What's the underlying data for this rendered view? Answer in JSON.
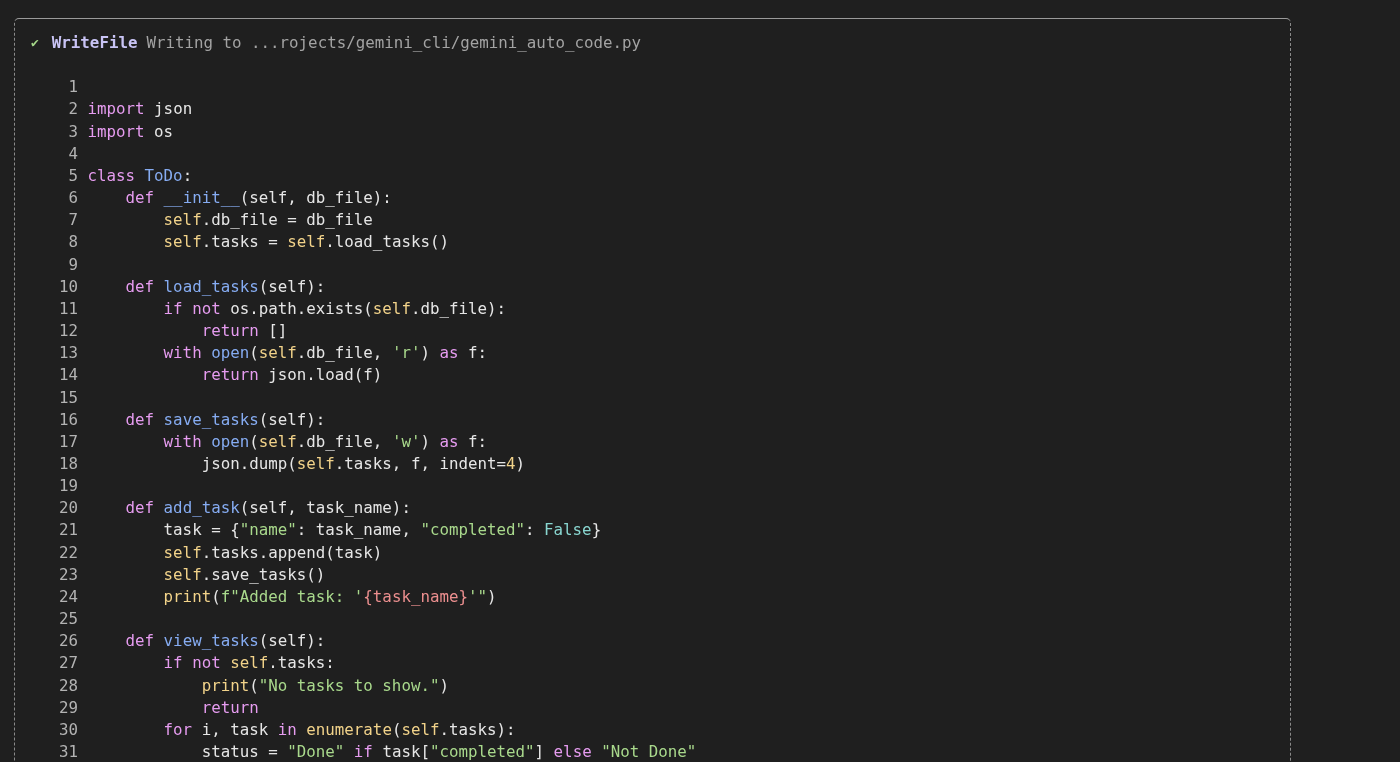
{
  "tool_call": {
    "status_icon": "✔",
    "tool_name": "WriteFile",
    "description": "Writing to ...rojects/gemini_cli/gemini_auto_code.py"
  },
  "code_lines": [
    {
      "number": "1"
    },
    {
      "number": "2",
      "tokens": [
        {
          "kind": "keyword",
          "text": "import"
        },
        {
          "kind": "plain",
          "text": " json"
        }
      ]
    },
    {
      "number": "3",
      "tokens": [
        {
          "kind": "keyword",
          "text": "import"
        },
        {
          "kind": "plain",
          "text": " os"
        }
      ]
    },
    {
      "number": "4"
    },
    {
      "number": "5",
      "tokens": [
        {
          "kind": "keyword",
          "text": "class"
        },
        {
          "kind": "name",
          "text": " ToDo"
        },
        {
          "kind": "plain",
          "text": ":"
        }
      ]
    },
    {
      "number": "6",
      "tokens": [
        {
          "kind": "keyword",
          "text": "    def"
        },
        {
          "kind": "name",
          "text": " __init__"
        },
        {
          "kind": "plain",
          "text": "(self, db_file):"
        }
      ]
    },
    {
      "number": "7",
      "tokens": [
        {
          "kind": "self",
          "text": "        self"
        },
        {
          "kind": "plain",
          "text": ".db_file = db_file"
        }
      ]
    },
    {
      "number": "8",
      "tokens": [
        {
          "kind": "self",
          "text": "        self"
        },
        {
          "kind": "plain",
          "text": ".tasks = "
        },
        {
          "kind": "self",
          "text": "self"
        },
        {
          "kind": "plain",
          "text": ".load_tasks()"
        }
      ]
    },
    {
      "number": "9"
    },
    {
      "number": "10",
      "tokens": [
        {
          "kind": "keyword",
          "text": "    def"
        },
        {
          "kind": "name",
          "text": " load_tasks"
        },
        {
          "kind": "plain",
          "text": "(self):"
        }
      ]
    },
    {
      "number": "11",
      "tokens": [
        {
          "kind": "keyword",
          "text": "        if not"
        },
        {
          "kind": "plain",
          "text": " os.path.exists("
        },
        {
          "kind": "self",
          "text": "self"
        },
        {
          "kind": "plain",
          "text": ".db_file):"
        }
      ]
    },
    {
      "number": "12",
      "tokens": [
        {
          "kind": "keyword",
          "text": "            return"
        },
        {
          "kind": "plain",
          "text": " []"
        }
      ]
    },
    {
      "number": "13",
      "tokens": [
        {
          "kind": "keyword",
          "text": "        with"
        },
        {
          "kind": "name",
          "text": " open"
        },
        {
          "kind": "plain",
          "text": "("
        },
        {
          "kind": "self",
          "text": "self"
        },
        {
          "kind": "plain",
          "text": ".db_file, "
        },
        {
          "kind": "string",
          "text": "'r'"
        },
        {
          "kind": "plain",
          "text": ")"
        },
        {
          "kind": "keyword",
          "text": " as"
        },
        {
          "kind": "plain",
          "text": " f:"
        }
      ]
    },
    {
      "number": "14",
      "tokens": [
        {
          "kind": "keyword",
          "text": "            return"
        },
        {
          "kind": "plain",
          "text": " json.load(f)"
        }
      ]
    },
    {
      "number": "15"
    },
    {
      "number": "16",
      "tokens": [
        {
          "kind": "keyword",
          "text": "    def"
        },
        {
          "kind": "name",
          "text": " save_tasks"
        },
        {
          "kind": "plain",
          "text": "(self):"
        }
      ]
    },
    {
      "number": "17",
      "tokens": [
        {
          "kind": "keyword",
          "text": "        with"
        },
        {
          "kind": "name",
          "text": " open"
        },
        {
          "kind": "plain",
          "text": "("
        },
        {
          "kind": "self",
          "text": "self"
        },
        {
          "kind": "plain",
          "text": ".db_file, "
        },
        {
          "kind": "string",
          "text": "'w'"
        },
        {
          "kind": "plain",
          "text": ")"
        },
        {
          "kind": "keyword",
          "text": " as"
        },
        {
          "kind": "plain",
          "text": " f:"
        }
      ]
    },
    {
      "number": "18",
      "tokens": [
        {
          "kind": "plain",
          "text": "            json.dump("
        },
        {
          "kind": "self",
          "text": "self"
        },
        {
          "kind": "plain",
          "text": ".tasks, f, indent="
        },
        {
          "kind": "number",
          "text": "4"
        },
        {
          "kind": "plain",
          "text": ")"
        }
      ]
    },
    {
      "number": "19"
    },
    {
      "number": "20",
      "tokens": [
        {
          "kind": "keyword",
          "text": "    def"
        },
        {
          "kind": "name",
          "text": " add_task"
        },
        {
          "kind": "plain",
          "text": "(self, task_name):"
        }
      ]
    },
    {
      "number": "21",
      "tokens": [
        {
          "kind": "plain",
          "text": "        task = {"
        },
        {
          "kind": "string",
          "text": "\"name\""
        },
        {
          "kind": "plain",
          "text": ": task_name, "
        },
        {
          "kind": "string",
          "text": "\"completed\""
        },
        {
          "kind": "plain",
          "text": ": "
        },
        {
          "kind": "constant",
          "text": "False"
        },
        {
          "kind": "plain",
          "text": "}"
        }
      ]
    },
    {
      "number": "22",
      "tokens": [
        {
          "kind": "self",
          "text": "        self"
        },
        {
          "kind": "plain",
          "text": ".tasks.append(task)"
        }
      ]
    },
    {
      "number": "23",
      "tokens": [
        {
          "kind": "self",
          "text": "        self"
        },
        {
          "kind": "plain",
          "text": ".save_tasks()"
        }
      ]
    },
    {
      "number": "24",
      "tokens": [
        {
          "kind": "call",
          "text": "        print"
        },
        {
          "kind": "plain",
          "text": "("
        },
        {
          "kind": "string",
          "text": "f\"Added task: '"
        },
        {
          "kind": "interpolation",
          "text": "{task_name}"
        },
        {
          "kind": "string",
          "text": "'\""
        },
        {
          "kind": "plain",
          "text": ")"
        }
      ]
    },
    {
      "number": "25"
    },
    {
      "number": "26",
      "tokens": [
        {
          "kind": "keyword",
          "text": "    def"
        },
        {
          "kind": "name",
          "text": " view_tasks"
        },
        {
          "kind": "plain",
          "text": "(self):"
        }
      ]
    },
    {
      "number": "27",
      "tokens": [
        {
          "kind": "keyword",
          "text": "        if not"
        },
        {
          "kind": "self",
          "text": " self"
        },
        {
          "kind": "plain",
          "text": ".tasks:"
        }
      ]
    },
    {
      "number": "28",
      "tokens": [
        {
          "kind": "call",
          "text": "            print"
        },
        {
          "kind": "plain",
          "text": "("
        },
        {
          "kind": "string",
          "text": "\"No tasks to show.\""
        },
        {
          "kind": "plain",
          "text": ")"
        }
      ]
    },
    {
      "number": "29",
      "tokens": [
        {
          "kind": "keyword",
          "text": "            return"
        }
      ]
    },
    {
      "number": "30",
      "tokens": [
        {
          "kind": "keyword",
          "text": "        for"
        },
        {
          "kind": "plain",
          "text": " i, task"
        },
        {
          "kind": "keyword",
          "text": " in"
        },
        {
          "kind": "call",
          "text": " enumerate"
        },
        {
          "kind": "plain",
          "text": "("
        },
        {
          "kind": "self",
          "text": "self"
        },
        {
          "kind": "plain",
          "text": ".tasks):"
        }
      ]
    },
    {
      "number": "31",
      "tokens": [
        {
          "kind": "plain",
          "text": "            status = "
        },
        {
          "kind": "string",
          "text": "\"Done\""
        },
        {
          "kind": "keyword",
          "text": " if"
        },
        {
          "kind": "plain",
          "text": " task["
        },
        {
          "kind": "string",
          "text": "\"completed\""
        },
        {
          "kind": "plain",
          "text": "]"
        },
        {
          "kind": "keyword",
          "text": " else"
        },
        {
          "kind": "string",
          "text": " \"Not Done\""
        }
      ]
    }
  ]
}
